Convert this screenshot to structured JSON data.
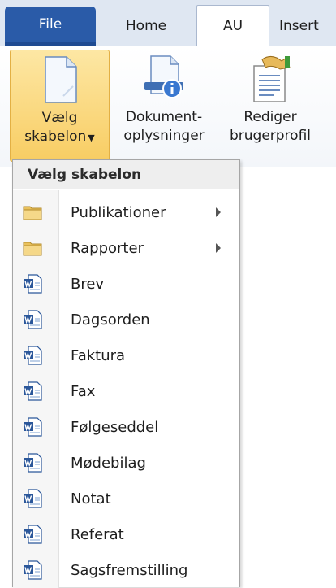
{
  "tabs": [
    {
      "label": "File"
    },
    {
      "label": "Home"
    },
    {
      "label": "AU"
    },
    {
      "label": "Insert"
    }
  ],
  "ribbon": {
    "choose_template": {
      "line1": "Vælg",
      "line2": "skabelon",
      "icon": "blank-page-icon",
      "dropdown": "chevron-down-icon"
    },
    "document_info": {
      "line1": "Dokument-",
      "line2": "oplysninger",
      "icon": "document-info-icon"
    },
    "edit_profile": {
      "line1": "Rediger",
      "line2": "brugerprofil",
      "icon": "hand-document-icon"
    }
  },
  "menu": {
    "header": "Vælg skabelon",
    "items": [
      {
        "label": "Publikationer",
        "icon": "folder-icon",
        "submenu": true
      },
      {
        "label": "Rapporter",
        "icon": "folder-icon",
        "submenu": true
      },
      {
        "label": "Brev",
        "icon": "word-document-icon"
      },
      {
        "label": "Dagsorden",
        "icon": "word-document-icon"
      },
      {
        "label": "Faktura",
        "icon": "word-document-icon"
      },
      {
        "label": "Fax",
        "icon": "word-document-icon"
      },
      {
        "label": "Følgeseddel",
        "icon": "word-document-icon"
      },
      {
        "label": "Mødebilag",
        "icon": "word-document-icon"
      },
      {
        "label": "Notat",
        "icon": "word-document-icon"
      },
      {
        "label": "Referat",
        "icon": "word-document-icon"
      },
      {
        "label": "Sagsfremstilling",
        "icon": "word-document-icon"
      }
    ]
  },
  "colors": {
    "file_tab": "#2a5ba8",
    "tab_strip": "#dfe7f2",
    "hover_gold": "#f8cd63"
  }
}
